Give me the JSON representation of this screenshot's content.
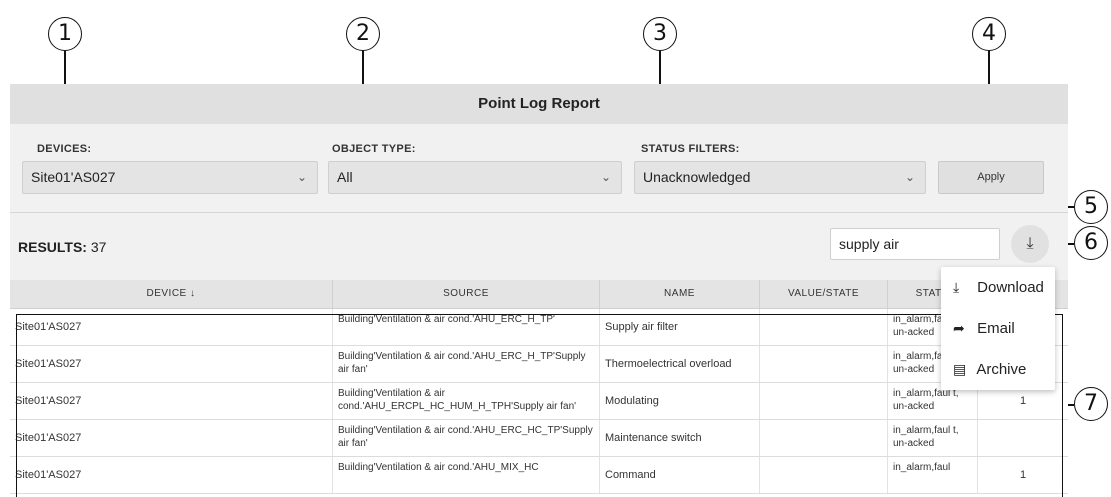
{
  "callouts": [
    "1",
    "2",
    "3",
    "4",
    "5",
    "6",
    "7"
  ],
  "report": {
    "title": "Point Log Report",
    "filters": {
      "devices_label": "DEVICES:",
      "devices_value": "Site01'AS027",
      "object_type_label": "OBJECT TYPE:",
      "object_type_value": "All",
      "status_label": "STATUS FILTERS:",
      "status_value": "Unacknowledged",
      "apply_label": "Apply"
    },
    "results": {
      "label": "RESULTS:",
      "count": "37"
    },
    "search": {
      "value": "supply air"
    },
    "icons": {
      "chevron": "chevron-down-icon",
      "download": "download-icon",
      "email": "email-icon",
      "archive": "archive-icon",
      "sort": "sort-down-arrow-icon"
    },
    "columns": [
      "DEVICE ↓",
      "SOURCE",
      "NAME",
      "VALUE/STATE",
      "STATU",
      ""
    ],
    "rows": [
      {
        "device": "Site01'AS027",
        "source": "Building'Ventilation & air cond.'AHU_ERC_H_TP'",
        "name": "Supply air filter",
        "value": "",
        "status": "in_alarm,faul t, un-acked",
        "count": ""
      },
      {
        "device": "Site01'AS027",
        "source": "Building'Ventilation & air cond.'AHU_ERC_H_TP'Supply air fan'",
        "name": "Thermoelectrical overload",
        "value": "",
        "status": "in_alarm,faul t, un-acked",
        "count": ""
      },
      {
        "device": "Site01'AS027",
        "source": "Building'Ventilation & air cond.'AHU_ERCPL_HC_HUM_H_TPH'Supply air fan'",
        "name": "Modulating",
        "value": "",
        "status": "in_alarm,faul t, un-acked",
        "count": "1"
      },
      {
        "device": "Site01'AS027",
        "source": "Building'Ventilation & air cond.'AHU_ERC_HC_TP'Supply air fan'",
        "name": "Maintenance switch",
        "value": "",
        "status": "in_alarm,faul t, un-acked",
        "count": ""
      },
      {
        "device": "Site01'AS027",
        "source": "Building'Ventilation & air cond.'AHU_MIX_HC",
        "name": "Command",
        "value": "",
        "status": "in_alarm,faul",
        "count": "1"
      }
    ],
    "menu": {
      "download_label": "Download",
      "email_label": "Email",
      "archive_label": "Archive"
    }
  }
}
